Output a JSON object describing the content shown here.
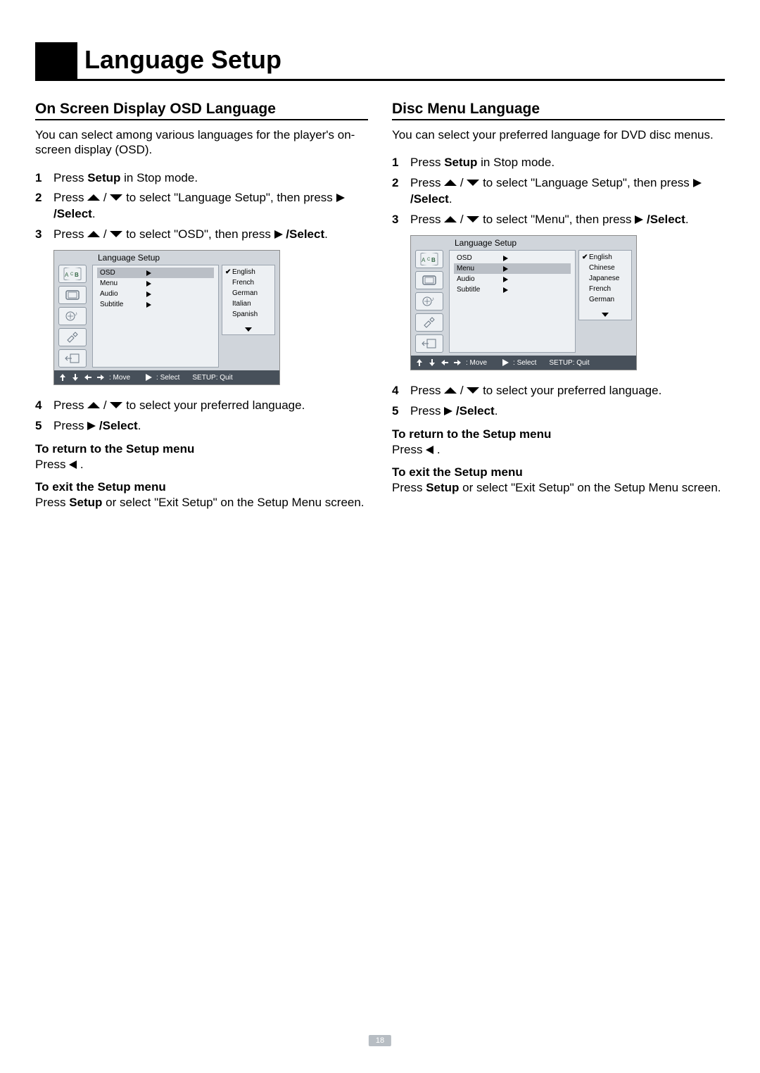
{
  "page_title": "Language Setup",
  "page_number": "18",
  "left": {
    "heading": "On Screen Display OSD Language",
    "intro": "You can select among various languages for the player's on-screen display (OSD).",
    "step1_a": "Press ",
    "step1_b": "Setup",
    "step1_c": " in Stop mode.",
    "step2_a": "Press ",
    "step2_b": " to select \"Language Setup\", then press ",
    "step2_c": " /Select",
    "step2_d": ".",
    "step3_a": "Press ",
    "step3_b": " to select \"OSD\", then press ",
    "step3_c": " /Select",
    "step3_d": ".",
    "step4": "Press ",
    "step4b": " to select your preferred language.",
    "step5a": "Press ",
    "step5b": " /Select",
    "step5c": ".",
    "return_title": "To return to the Setup menu",
    "return_text": "Press ",
    "return_text2": " .",
    "exit_title": "To exit the Setup menu",
    "exit_a": "Press ",
    "exit_b": "Setup",
    "exit_c": " or select \"Exit Setup\" on the Setup Menu screen.",
    "osd": {
      "title": "Language Setup",
      "rows": [
        "OSD",
        "Menu",
        "Audio",
        "Subtitle"
      ],
      "highlight": 0,
      "languages": [
        "English",
        "French",
        "German",
        "Italian",
        "Spanish"
      ],
      "footer_move": ": Move",
      "footer_select": ": Select",
      "footer_quit": "SETUP: Quit"
    }
  },
  "right": {
    "heading": "Disc Menu Language",
    "intro": "You can select your preferred language for DVD disc menus.",
    "step1_a": "Press ",
    "step1_b": "Setup",
    "step1_c": " in Stop mode.",
    "step2_a": "Press ",
    "step2_b": " to select \"Language Setup\", then press ",
    "step2_c": " /Select",
    "step2_d": ".",
    "step3_a": "Press ",
    "step3_b": " to select \"Menu\", then press ",
    "step3_c": " /Select",
    "step3_d": ".",
    "step4": "Press ",
    "step4b": " to select your preferred language.",
    "step5a": "Press ",
    "step5b": " /Select",
    "step5c": ".",
    "return_title": "To return to the Setup menu",
    "return_text": "Press ",
    "return_text2": " .",
    "exit_title": "To exit the Setup menu",
    "exit_a": "Press ",
    "exit_b": "Setup",
    "exit_c": " or select \"Exit Setup\" on the Setup Menu screen.",
    "osd": {
      "title": "Language Setup",
      "rows": [
        "OSD",
        "Menu",
        "Audio",
        "Subtitle"
      ],
      "highlight": 1,
      "languages": [
        "English",
        "Chinese",
        "Japanese",
        "French",
        "German"
      ],
      "footer_move": ": Move",
      "footer_select": ": Select",
      "footer_quit": "SETUP: Quit"
    }
  }
}
